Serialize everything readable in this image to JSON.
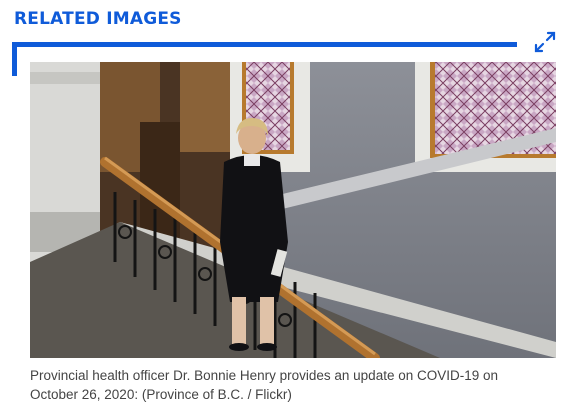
{
  "related": {
    "heading": "RELATED IMAGES",
    "expand_icon": "expand-arrows-icon",
    "accent_color": "#0f5bd9",
    "photo": {
      "alt": "Provincial health officer Dr. Bonnie Henry walking down a wooden staircase beside stained-glass windows"
    },
    "caption_line1": "Provincial health officer Dr. Bonnie Henry provides an update on COVID-19 on",
    "caption_line2": "October 26, 2020: (Province of B.C. / Flickr)"
  }
}
